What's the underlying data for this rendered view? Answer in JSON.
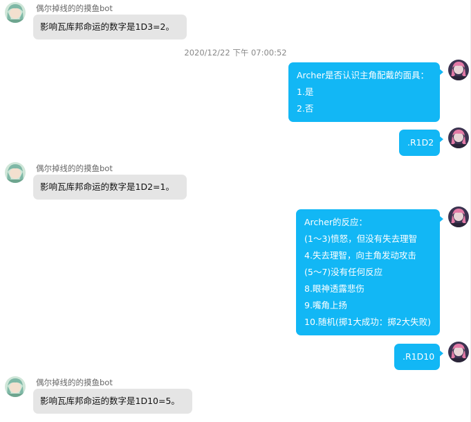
{
  "timestamp": "2020/12/22 下午 07:00:52",
  "bot": {
    "name": "偶尔掉线的的摸鱼bot"
  },
  "messages": {
    "m1": {
      "text": "影响瓦库邦命运的数字是1D3=2。"
    },
    "m2": {
      "lines": [
        "Archer是否认识主角配戴的面具：",
        "1.是",
        "2.否"
      ]
    },
    "m3": {
      "text": ".R1D2"
    },
    "m4": {
      "text": "影响瓦库邦命运的数字是1D2=1。"
    },
    "m5": {
      "lines": [
        "Archer的反应：",
        "(1～3)愤怒，但没有失去理智",
        "4.失去理智，向主角发动攻击",
        "(5～7)没有任何反应",
        "8.眼神透露悲伤",
        "9.嘴角上扬",
        "10.随机(掷1大成功：掷2大失败)"
      ]
    },
    "m6": {
      "text": ".R1D10"
    },
    "m7": {
      "text": "影响瓦库邦命运的数字是1D10=5。"
    }
  },
  "colors": {
    "outgoing_bubble": "#12b7f5",
    "incoming_bubble": "#e5e5e5"
  },
  "icons": {
    "bot_avatar": "bot-avatar-icon",
    "user_avatar": "user-avatar-icon"
  }
}
